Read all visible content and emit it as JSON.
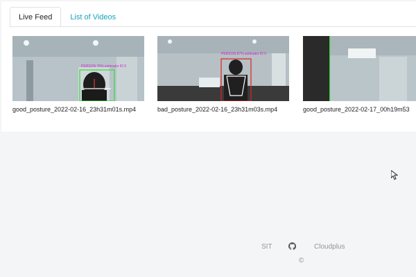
{
  "tabs": [
    {
      "label": "Live Feed",
      "active": true
    },
    {
      "label": "List of Videos",
      "active": false
    }
  ],
  "videos": [
    {
      "name": "good_posture_2022-02-16_23h31m01s.mp4",
      "overlay": "PERSON 76% estimator ID 0"
    },
    {
      "name": "bad_posture_2022-02-16_23h31m03s.mp4",
      "overlay": "PERSON 87% estimator ID 0"
    },
    {
      "name": "good_posture_2022-02-17_00h19m53"
    }
  ],
  "footer": {
    "left_link": "SIT",
    "github_icon": "github-icon",
    "right_link": "Cloudplus",
    "copyright": "©"
  },
  "colors": {
    "tab_inactive": "#17a2b8",
    "box_green": "#33dd33",
    "box_red": "#dd2222",
    "overlay_magenta": "#cc22cc"
  }
}
